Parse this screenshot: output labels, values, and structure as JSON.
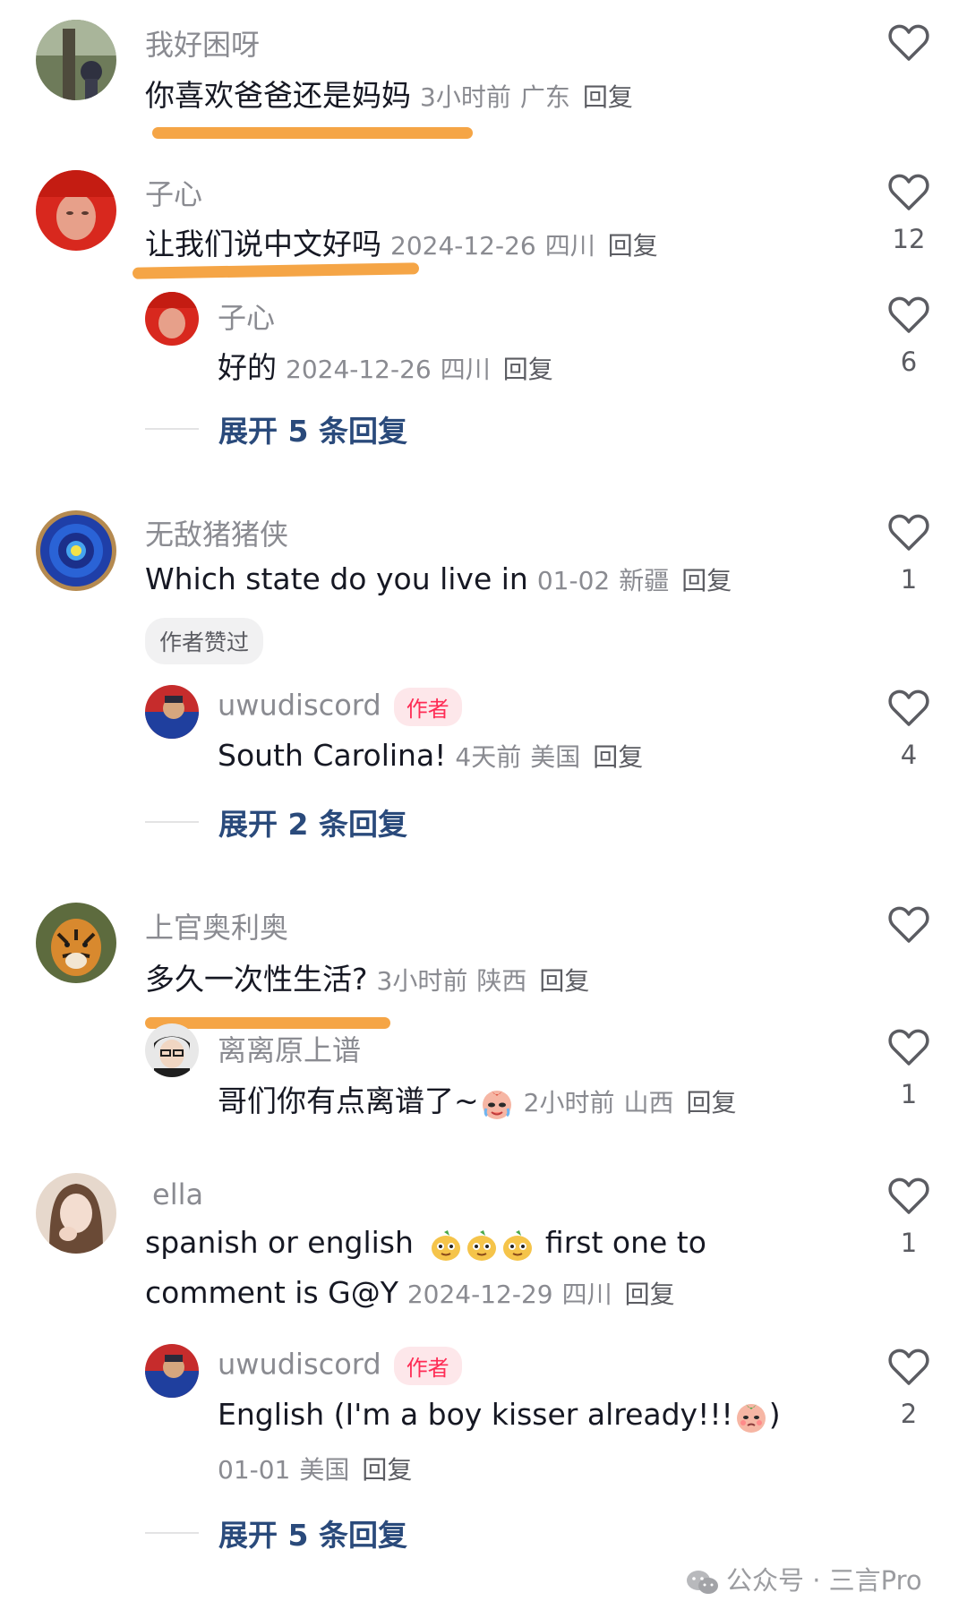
{
  "comments": [
    {
      "username": "我好困呀",
      "text": "你喜欢爸爸还是妈妈",
      "time": "3小时前",
      "location": "广东",
      "reply_label": "回复",
      "likes": ""
    },
    {
      "username": "子心",
      "text": "让我们说中文好吗",
      "time": "2024-12-26",
      "location": "四川",
      "reply_label": "回复",
      "likes": "12",
      "reply": {
        "username": "子心",
        "text": "好的",
        "time": "2024-12-26",
        "location": "四川",
        "reply_label": "回复",
        "likes": "6"
      },
      "expand_label": "展开 5 条回复"
    },
    {
      "username": "无敌猪猪侠",
      "text": "Which state do you live in",
      "time": "01-02",
      "location": "新疆",
      "reply_label": "回复",
      "likes": "1",
      "badge": "作者赞过",
      "reply": {
        "username": "uwudiscord",
        "author_badge": "作者",
        "text": "South Carolina!",
        "time": "4天前",
        "location": "美国",
        "reply_label": "回复",
        "likes": "4"
      },
      "expand_label": "展开 2 条回复"
    },
    {
      "username": "上官奥利奥",
      "text": "多久一次性生活?",
      "time": "3小时前",
      "location": "陕西",
      "reply_label": "回复",
      "likes": "",
      "reply": {
        "username": "离离原上谱",
        "text": "哥们你有点离谱了~",
        "time": "2小时前",
        "location": "山西",
        "reply_label": "回复",
        "likes": "1"
      }
    },
    {
      "username": "ella",
      "text_line1_a": "spanish or english",
      "text_line1_b": "first one to",
      "text_line2": "comment is G@Y",
      "time": "2024-12-29",
      "location": "四川",
      "reply_label": "回复",
      "likes": "1",
      "reply": {
        "username": "uwudiscord",
        "author_badge": "作者",
        "text": "English (I'm a boy kisser already!!!",
        "text_end": ")",
        "time": "01-01",
        "location": "美国",
        "reply_label": "回复",
        "likes": "2"
      },
      "expand_label": "展开 5 条回复"
    }
  ],
  "watermark": {
    "text": "公众号 · 三言Pro",
    "icon": "wechat-icon"
  },
  "colors": {
    "highlight_underline": "#f5a546",
    "author_badge": "#fe2c55",
    "expand_link": "#2a4a7b"
  }
}
